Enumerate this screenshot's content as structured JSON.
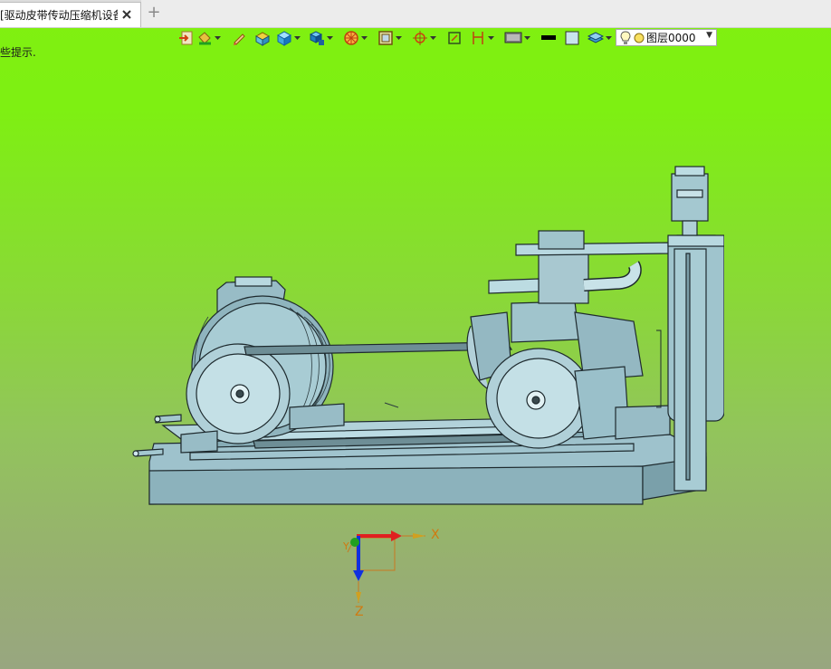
{
  "tab": {
    "title": "[驱动皮带传动压缩机设备]",
    "add_label": "+"
  },
  "hint_text": "些提示.",
  "toolbar": {
    "items": [
      "import-icon",
      "paint-bucket-icon",
      "pencil-icon",
      "box-highlight-icon",
      "cube-icon",
      "cube-stack-icon",
      "render-mode-icon",
      "frame-icon",
      "snap-target-icon",
      "fit-view-icon",
      "dimension-icon",
      "display-icon",
      "line-color-swatch",
      "fill-color-swatch",
      "layer-stack-icon"
    ],
    "layer": {
      "value": "图层0000",
      "bulb_icon": "lightbulb-icon",
      "sun_icon": "layer-color-dot-icon"
    }
  },
  "axes": {
    "x_label": "X",
    "z_label": "Z",
    "y_label": "Y"
  },
  "colors": {
    "background_top": "#80f010",
    "background_bottom": "#98a680",
    "model_fill": "#a4c8d0",
    "model_edge": "#1e2a2e",
    "axis_x": "#e02020",
    "axis_z": "#1030e0",
    "axis_y": "#20a020",
    "label": "#d07a10"
  }
}
